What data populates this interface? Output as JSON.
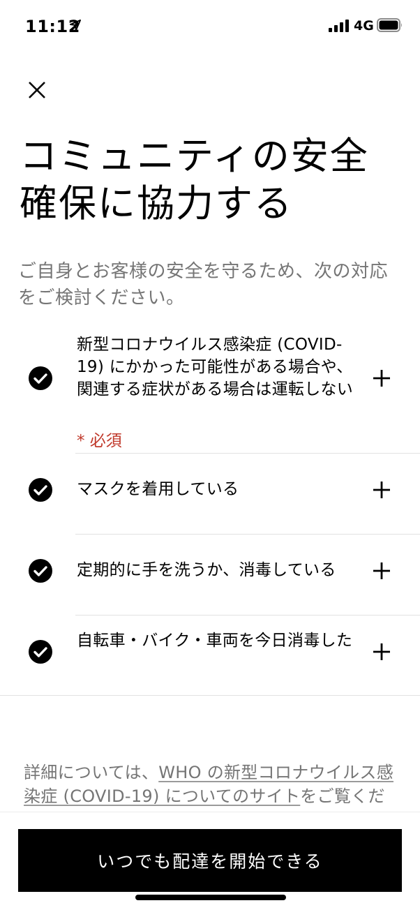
{
  "status_bar": {
    "time": "11:12",
    "network": "4G"
  },
  "header": {
    "title_line1": "コミュニティの安全",
    "title_line2": "確保に協力する",
    "subtitle": "ご自身とお客様の安全を守るため、次の対応をご検討ください。"
  },
  "checklist": [
    {
      "text": "新型コロナウイルス感染症 (COVID-19) にかかった可能性がある場合や、関連する症状がある場合は運転しない",
      "required": "* 必須",
      "checked": true
    },
    {
      "text": "マスクを着用している",
      "checked": true
    },
    {
      "text": "定期的に手を洗うか、消毒している",
      "checked": true
    },
    {
      "text": "自転車・バイク・車両を今日消毒した",
      "checked": true
    }
  ],
  "info": {
    "prefix": "詳細については、",
    "link": "WHO の新型コロナウイルス感染症 (COVID-19) についてのサイト",
    "suffix": "をご覧ください。"
  },
  "cta": {
    "label": "いつでも配達を開始できる"
  },
  "colors": {
    "accent": "#000000",
    "required": "#c0392b",
    "muted_text": "#757575"
  },
  "icons": [
    "location-arrow-icon",
    "signal-icon",
    "battery-icon",
    "close-icon",
    "check-circle-icon",
    "plus-icon"
  ]
}
